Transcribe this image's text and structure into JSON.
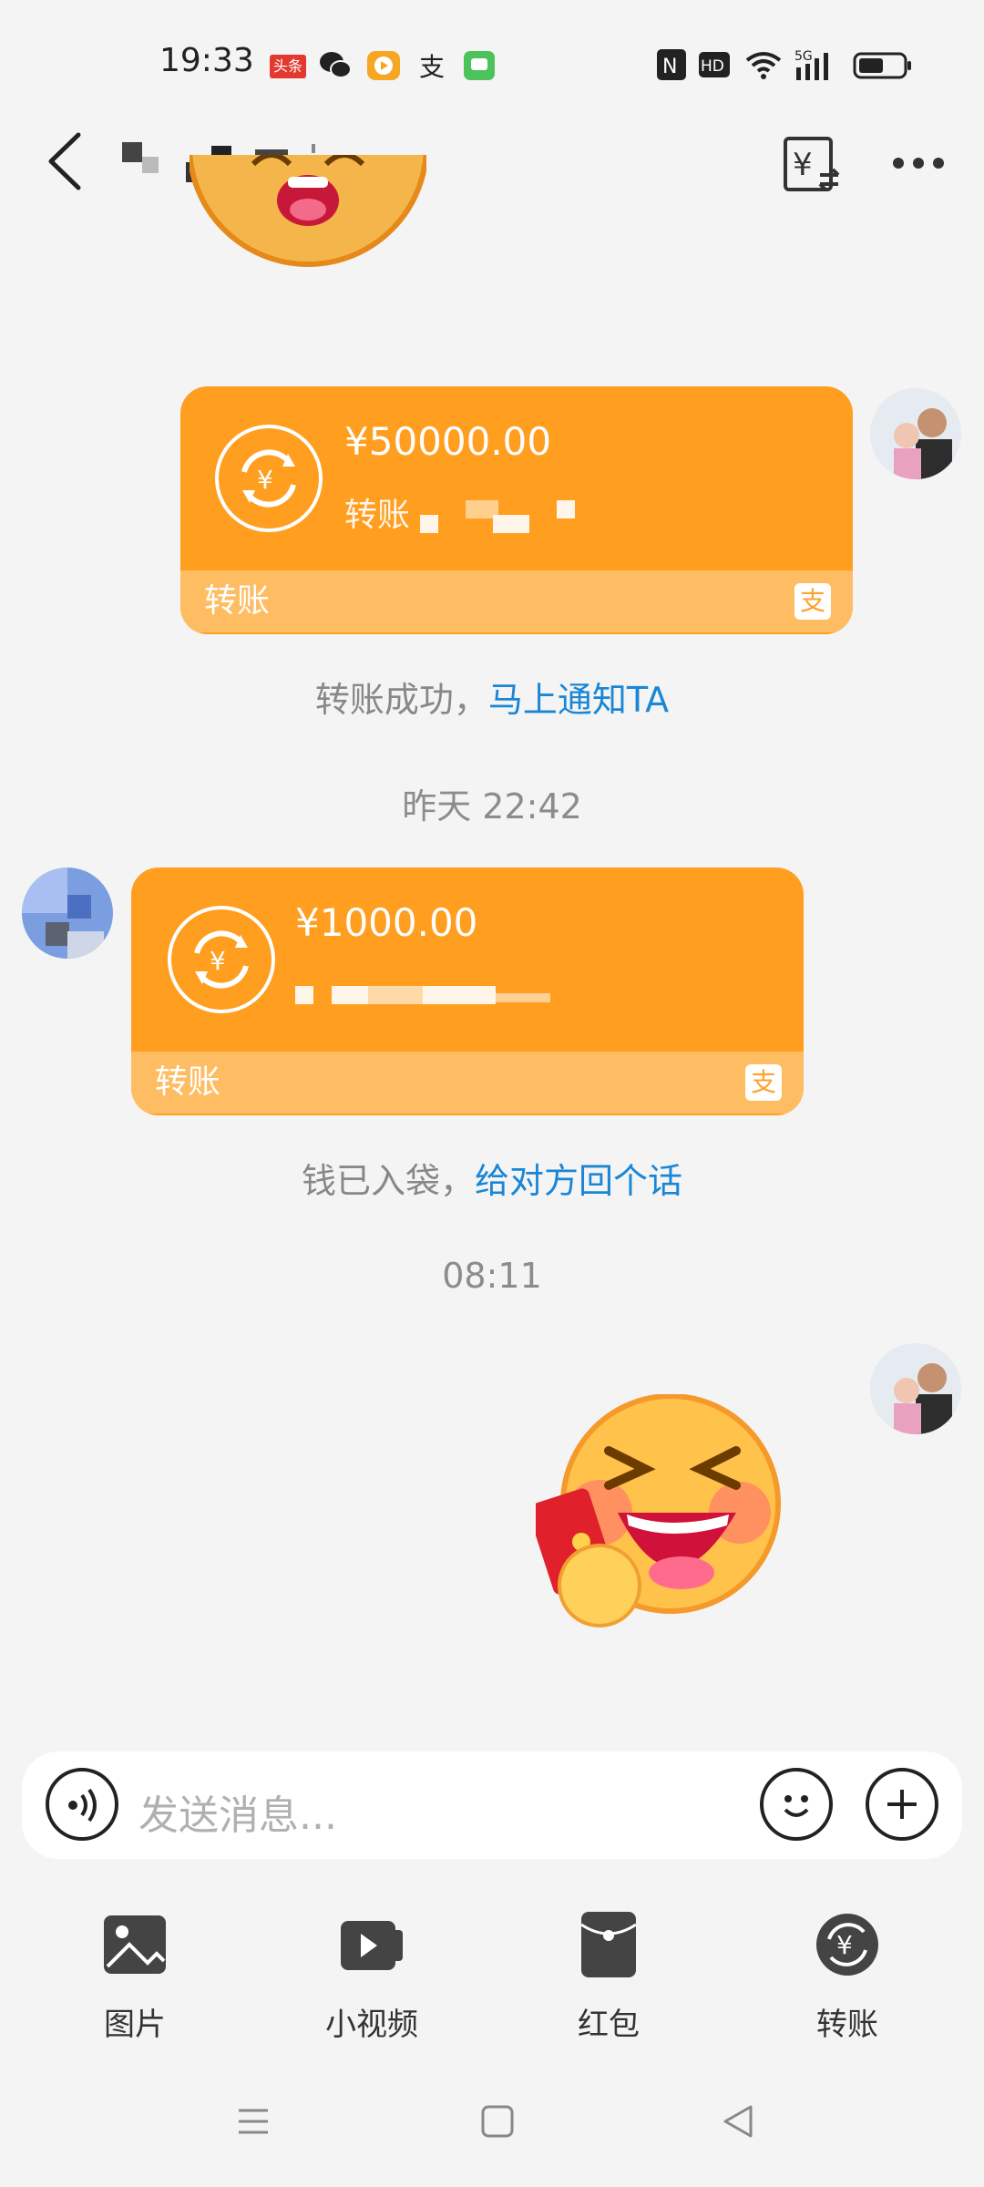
{
  "status_bar": {
    "time": "19:33",
    "toutiao_label": "头条",
    "icons_left": [
      "toutiao-icon",
      "wechat-icon",
      "video-app-icon",
      "alipay-icon",
      "message-icon"
    ],
    "icons_right": [
      "nfc-icon",
      "hd-icon",
      "wifi-icon",
      "5g-signal-icon",
      "battery-icon"
    ],
    "network": "5G",
    "hd": "HD"
  },
  "header": {
    "back_icon": "chevron-left-icon",
    "transfer_icon": "yuan-transfer-icon",
    "more_icon": "more-dots-icon"
  },
  "messages": {
    "transfer1": {
      "amount": "¥50000.00",
      "memo": "转账",
      "footer_label": "转账",
      "brand_icon": "alipay-icon"
    },
    "notice1": {
      "text": "转账成功，",
      "link": "马上通知TA"
    },
    "time1": "昨天 22:42",
    "transfer2": {
      "amount": "¥1000.00",
      "footer_label": "转账",
      "brand_icon": "alipay-icon"
    },
    "notice2": {
      "text": "钱已入袋，",
      "link": "给对方回个话"
    },
    "time2": "08:11"
  },
  "input": {
    "placeholder": "发送消息..."
  },
  "tools": [
    {
      "label": "图片",
      "icon": "image-icon"
    },
    {
      "label": "小视频",
      "icon": "video-icon"
    },
    {
      "label": "红包",
      "icon": "red-packet-icon"
    },
    {
      "label": "转账",
      "icon": "transfer-icon"
    }
  ],
  "colors": {
    "card": "#ff9e1f",
    "card_footer": "#ffbd63",
    "link": "#1a86d6",
    "background": "#f4f4f4"
  }
}
